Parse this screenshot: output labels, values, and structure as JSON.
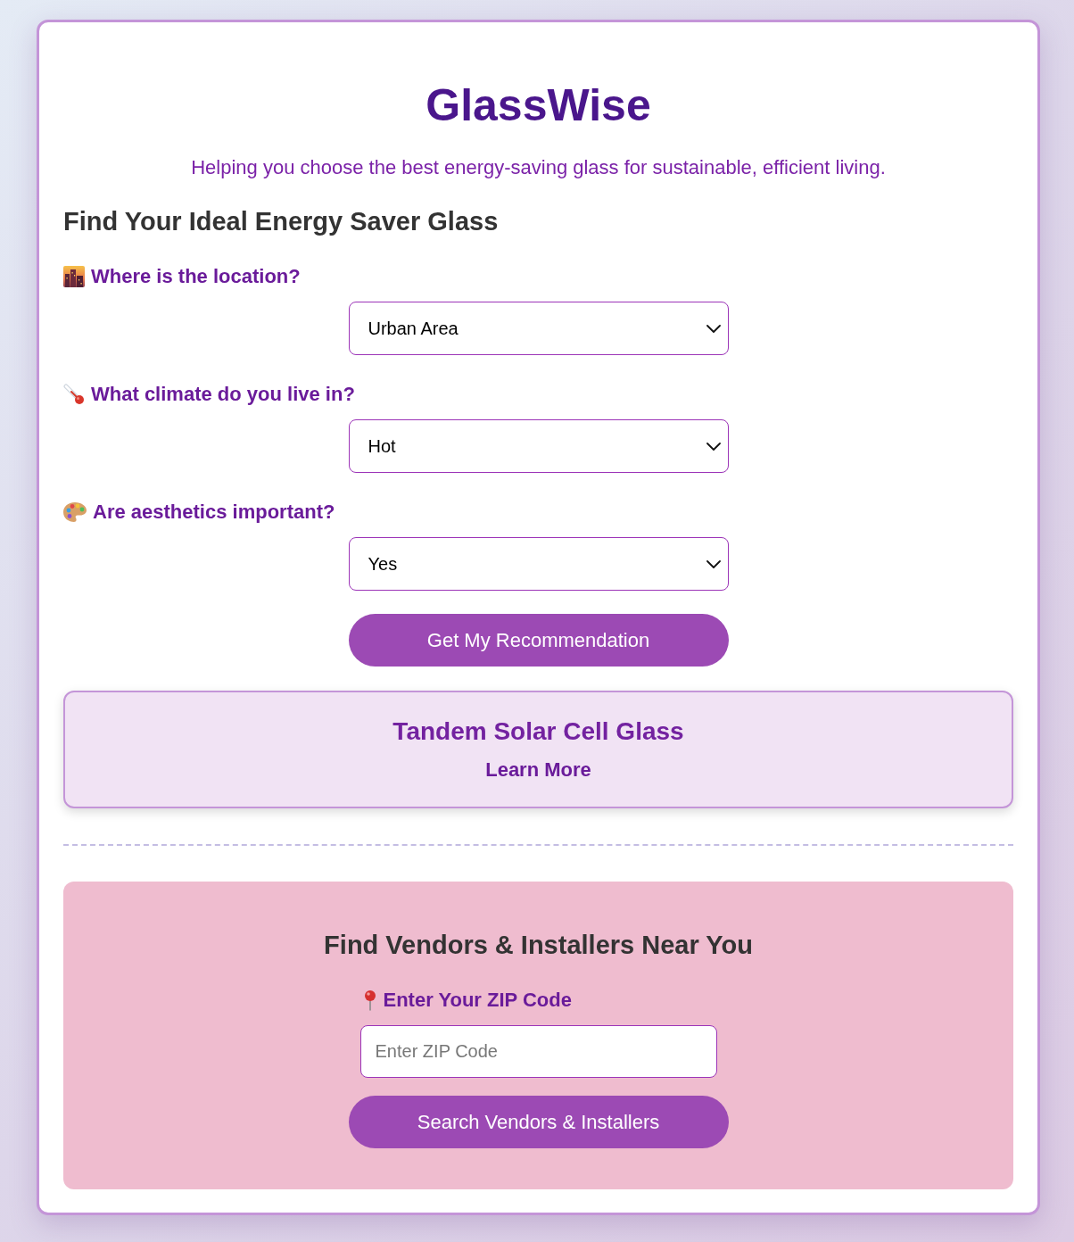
{
  "header": {
    "title": "GlassWise",
    "tagline": "Helping you choose the best energy-saving glass for sustainable, efficient living."
  },
  "finder": {
    "heading": "Find Your Ideal Energy Saver Glass",
    "questions": [
      {
        "label": "Where is the location?",
        "value": "Urban Area"
      },
      {
        "label": "What climate do you live in?",
        "value": "Hot"
      },
      {
        "label": "Are aesthetics important?",
        "value": "Yes"
      }
    ],
    "submit_button": "Get My Recommendation"
  },
  "recommendation": {
    "name": "Tandem Solar Cell Glass",
    "link": "Learn More"
  },
  "vendors": {
    "heading": "Find Vendors & Installers Near You",
    "zip_label": "Enter Your ZIP Code",
    "zip_field": {
      "placeholder": "Enter ZIP Code"
    },
    "search_button": "Search Vendors & Installers"
  }
}
